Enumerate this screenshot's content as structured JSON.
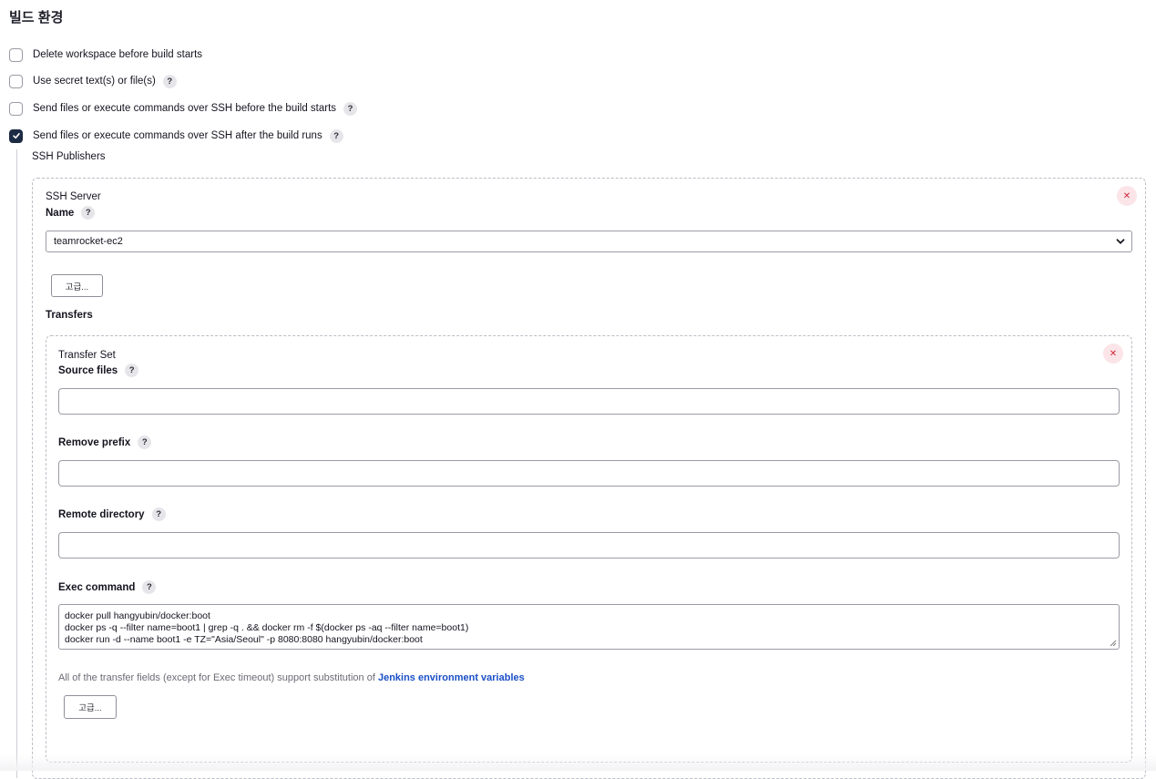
{
  "section": {
    "title": "빌드 환경"
  },
  "options": [
    {
      "label": "Delete workspace before build starts",
      "checked": false,
      "help": false
    },
    {
      "label": "Use secret text(s) or file(s)",
      "checked": false,
      "help": true
    },
    {
      "label": "Send files or execute commands over SSH before the build starts",
      "checked": false,
      "help": true
    },
    {
      "label": "Send files or execute commands over SSH after the build runs",
      "checked": true,
      "help": true
    }
  ],
  "help_glyph": "?",
  "close_glyph": "✕",
  "publishers": {
    "title": "SSH Publishers",
    "server": {
      "heading": "SSH Server",
      "name_label": "Name",
      "name_value": "teamrocket-ec2",
      "advanced_label": "고급...",
      "transfers_label": "Transfers",
      "transfer_set": {
        "heading": "Transfer Set",
        "source_files_label": "Source files",
        "source_files_value": "",
        "remove_prefix_label": "Remove prefix",
        "remove_prefix_value": "",
        "remote_directory_label": "Remote directory",
        "remote_directory_value": "",
        "exec_command_label": "Exec command",
        "exec_command_lines": [
          "docker pull hangyubin/docker:boot",
          "docker ps -q --filter name=boot1 | grep -q . && docker rm -f $(docker ps -aq --filter name=boot1)",
          "docker run -d --name boot1 -e TZ=\"Asia/Seoul\" -p 8080:8080 hangyubin/docker:boot"
        ],
        "note_text": "All of the transfer fields (except for Exec timeout) support substitution of ",
        "note_link": "Jenkins environment variables",
        "advanced_label": "고급..."
      }
    }
  },
  "colors": {
    "checkbox_checked": "#1d2a44",
    "link": "#1a4fc7",
    "close_bg": "#fbe5e8",
    "close_fg": "#d3263a"
  }
}
